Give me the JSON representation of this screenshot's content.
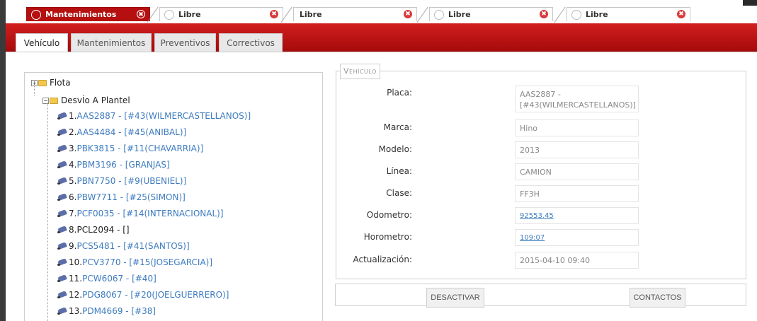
{
  "window_tabs": [
    {
      "label": "Mantenimientos",
      "active": true
    },
    {
      "label": "Libre",
      "active": false
    },
    {
      "label": "Libre",
      "active": false
    },
    {
      "label": "Libre",
      "active": false
    },
    {
      "label": "Libre",
      "active": false
    }
  ],
  "close_glyph": "✖",
  "inner_tabs": [
    {
      "label": "Vehículo",
      "active": true
    },
    {
      "label": "Mantenimientos",
      "active": false
    },
    {
      "label": "Preventivos",
      "active": false
    },
    {
      "label": "Correctivos",
      "active": false
    }
  ],
  "tree": {
    "root": {
      "label": "Flota",
      "expander": "+"
    },
    "group": {
      "label": "DesvÍo A Plantel",
      "expander": "−"
    },
    "vehicles": [
      {
        "num": "1.",
        "text": "AAS2887 - [#43(WILMERCASTELLANOS)]",
        "link": true
      },
      {
        "num": "2.",
        "text": "AAS4484 - [#45(ANIBAL)]",
        "link": true
      },
      {
        "num": "3.",
        "text": "PBK3815 - [#11(CHAVARRIA)]",
        "link": true
      },
      {
        "num": "4.",
        "text": "PBM3196 - [GRANJAS]",
        "link": true
      },
      {
        "num": "5.",
        "text": "PBN7750 - [#9(UBENIEL)]",
        "link": true
      },
      {
        "num": "6.",
        "text": "PBW7711 - [#25(SIMON)]",
        "link": true
      },
      {
        "num": "7.",
        "text": "PCF0035 - [#14(INTERNACIONAL)]",
        "link": true
      },
      {
        "num": "8.",
        "text": "PCL2094 - []",
        "link": false
      },
      {
        "num": "9.",
        "text": "PCS5481 - [#41(SANTOS)]",
        "link": true
      },
      {
        "num": "10.",
        "text": "PCV3770 - [#15(JOSEGARCIA)]",
        "link": true
      },
      {
        "num": "11.",
        "text": "PCW6067 - [#40]",
        "link": true
      },
      {
        "num": "12.",
        "text": "PDG8067 - [#20(JOELGUERRERO)]",
        "link": true
      },
      {
        "num": "13.",
        "text": "PDM4669 - [#38]",
        "link": true
      }
    ]
  },
  "vehicle_panel": {
    "legend": "Vehículo",
    "fields": [
      {
        "label": "Placa:",
        "value": "AAS2887 - [#43(WILMERCASTELLANOS)]",
        "link": false
      },
      {
        "label": "Marca:",
        "value": "Hino",
        "link": false
      },
      {
        "label": "Modelo:",
        "value": "2013",
        "link": false
      },
      {
        "label": "Línea:",
        "value": "CAMION",
        "link": false
      },
      {
        "label": "Clase:",
        "value": "FF3H",
        "link": false
      },
      {
        "label": "Odometro:",
        "value": "92553.45",
        "link": true
      },
      {
        "label": "Horometro:",
        "value": "109:07",
        "link": true
      },
      {
        "label": "Actualización:",
        "value": "2015-04-10 09:40",
        "link": false
      }
    ]
  },
  "actions": {
    "deactivate_label": "DESACTIVAR",
    "contacts_label": "CONTACTOS"
  },
  "colors": {
    "brand_red": "#b50f0f",
    "link_blue": "#3d7bbf"
  }
}
